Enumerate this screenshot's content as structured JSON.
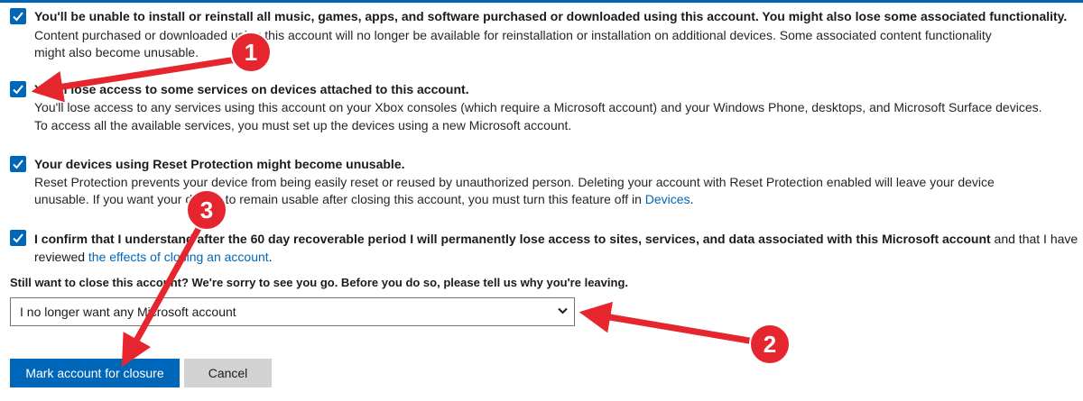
{
  "items": [
    {
      "title": "You'll be unable to install or reinstall all music, games, apps, and software purchased or downloaded using this account. You might also lose some associated functionality.",
      "desc_line1": "Content purchased or downloaded using this account will no longer be available for reinstallation or installation on additional devices. Some associated content functionality",
      "desc_line2": "might also become unusable."
    },
    {
      "title": "You'll lose access to some services on devices attached to this account.",
      "desc_line1": "You'll lose access to any services using this account on your Xbox consoles (which require a Microsoft account) and your Windows Phone, desktops, and Microsoft Surface devices.",
      "desc_line2": "To access all the available services, you must set up the devices using a new Microsoft account."
    },
    {
      "title": "Your devices using Reset Protection might become unusable.",
      "desc_line1": "Reset Protection prevents your device from being easily reset or reused by unauthorized person. Deleting your account with Reset Protection enabled will leave your device",
      "desc_line2_prefix": "unusable. If you want your device to remain usable after closing this account, you must turn this feature off in ",
      "desc_line2_link": "Devices",
      "desc_line2_suffix": "."
    }
  ],
  "confirm": {
    "bold": "I confirm that I understand after the 60 day recoverable period I will permanently lose access to sites, services, and data associated with this Microsoft account",
    "rest": " and that I have reviewed ",
    "link": "the effects of closing an account",
    "end": "."
  },
  "prompt": "Still want to close this account? We're sorry to see you go. Before you do so, please tell us why you're leaving.",
  "reason_select": {
    "selected": "I no longer want any Microsoft account"
  },
  "buttons": {
    "primary": "Mark account for closure",
    "secondary": "Cancel"
  },
  "annotations": {
    "badge1": "1",
    "badge2": "2",
    "badge3": "3"
  },
  "colors": {
    "accent": "#0067b8",
    "annotation": "#e5262f"
  },
  "icons": {
    "checkbox": "check-icon",
    "select": "chevron-down-icon"
  }
}
